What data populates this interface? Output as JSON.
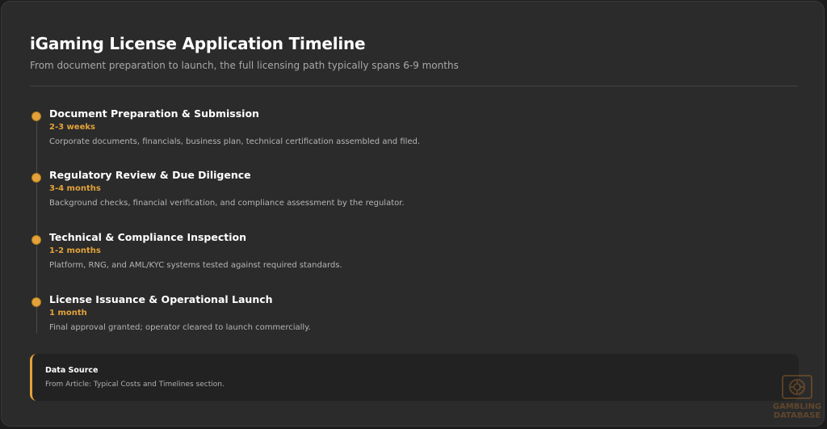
{
  "header": {
    "title": "iGaming License Application Timeline",
    "subtitle": "From document preparation to launch, the full licensing path typically spans 6-9 months"
  },
  "steps": [
    {
      "title": "Document Preparation & Submission",
      "duration": "2-3 weeks",
      "description": "Corporate documents, financials, business plan, technical certification assembled and filed."
    },
    {
      "title": "Regulatory Review & Due Diligence",
      "duration": "3-4 months",
      "description": "Background checks, financial verification, and compliance assessment by the regulator."
    },
    {
      "title": "Technical & Compliance Inspection",
      "duration": "1-2 months",
      "description": "Platform, RNG, and AML/KYC systems tested against required standards."
    },
    {
      "title": "License Issuance & Operational Launch",
      "duration": "1 month",
      "description": "Final approval granted; operator cleared to launch commercially."
    }
  ],
  "source": {
    "title": "Data Source",
    "text": "From Article: Typical Costs and Timelines section."
  },
  "watermark": {
    "line1": "GAMBLING",
    "line2": "DATABASE"
  },
  "colors": {
    "accent": "#e3a33a",
    "background": "#2b2b2b",
    "text": "#ffffff",
    "muted": "#b5b5b5"
  },
  "icons": [
    "timeline-dot-icon",
    "gambling-database-logo-icon"
  ]
}
